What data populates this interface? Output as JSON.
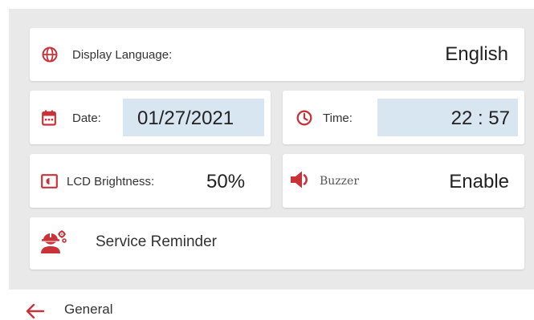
{
  "colors": {
    "accent": "#c8333a",
    "field_bg": "#d8e6f1",
    "panel_bg": "#e9e9e9"
  },
  "language": {
    "icon": "globe-icon",
    "label": "Display Language:",
    "value": "English"
  },
  "date": {
    "icon": "calendar-icon",
    "label": "Date:",
    "value": "01/27/2021"
  },
  "time": {
    "icon": "clock-icon",
    "label": "Time:",
    "value": "22 : 57"
  },
  "brightness": {
    "icon": "brightness-icon",
    "label": "LCD Brightness:",
    "value": "50%"
  },
  "buzzer": {
    "icon": "speaker-icon",
    "label": "Buzzer",
    "value": "Enable"
  },
  "service": {
    "icon": "technician-icon",
    "label": "Service Reminder"
  },
  "footer": {
    "back_icon": "back-arrow-icon",
    "title": "General"
  }
}
